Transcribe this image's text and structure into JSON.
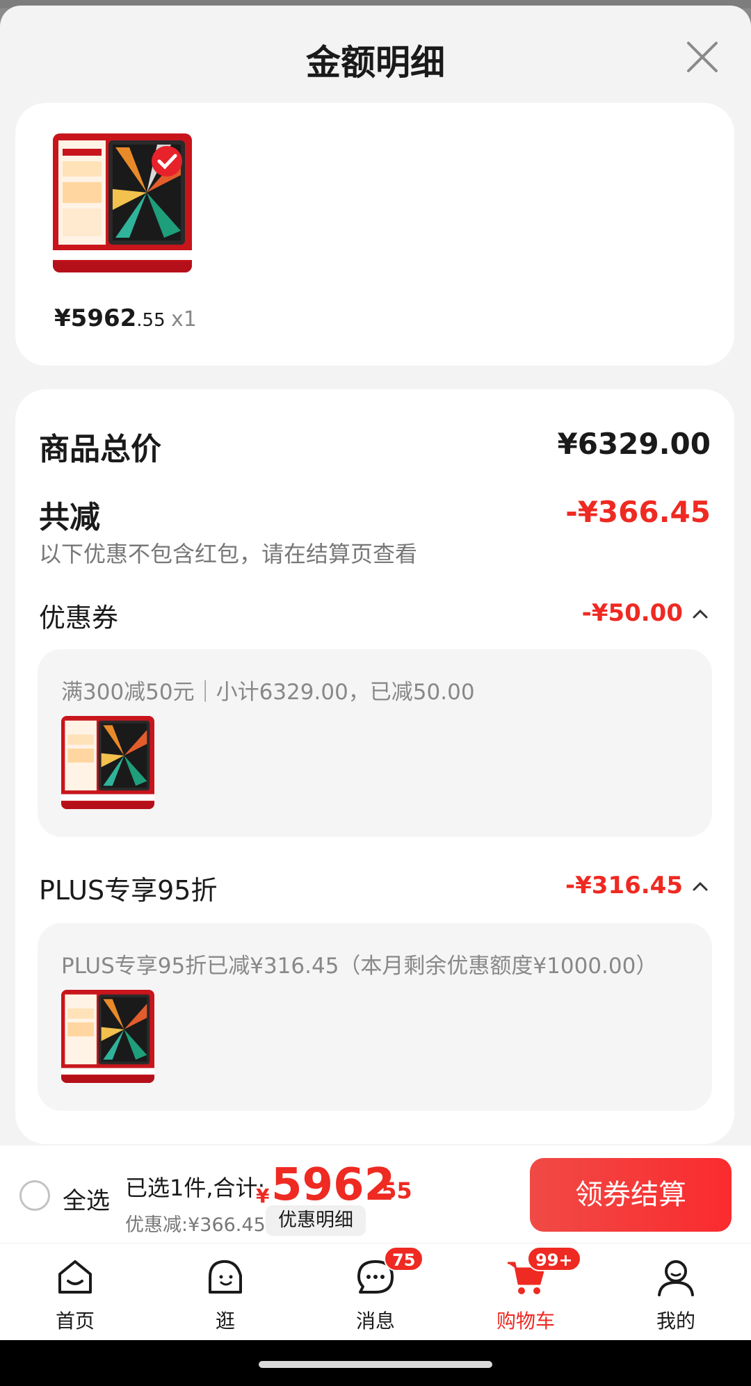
{
  "sheet": {
    "title": "金额明细"
  },
  "product": {
    "price_int": "¥5962",
    "price_dec": ".55",
    "qty": "x1"
  },
  "summary": {
    "total_label": "商品总价",
    "total_value": "¥6329.00",
    "reduce_label": "共减",
    "reduce_value": "-¥366.45",
    "reduce_note": "以下优惠不包含红包，请在结算页查看"
  },
  "coupon": {
    "label": "优惠券",
    "value": "-¥50.00",
    "detail": "满300减50元｜小计6329.00，已减50.00"
  },
  "plus": {
    "label": "PLUS专享95折",
    "value": "-¥316.45",
    "detail": "PLUS专享95折已减¥316.45（本月剩余优惠额度¥1000.00）"
  },
  "checkout": {
    "select_all": "全选",
    "selected_text": "已选1件,合计:",
    "total_yen": "¥",
    "total_int": "5962",
    "total_dec": ".55",
    "discount_text": "优惠减:¥366.45",
    "detail_chip": "优惠明细",
    "button": "领券结算"
  },
  "tabs": [
    {
      "label": "首页",
      "icon": "home-icon"
    },
    {
      "label": "逛",
      "icon": "explore-icon"
    },
    {
      "label": "消息",
      "icon": "message-icon",
      "badge": "75"
    },
    {
      "label": "购物车",
      "icon": "cart-icon",
      "badge": "99+",
      "active": true
    },
    {
      "label": "我的",
      "icon": "profile-icon"
    }
  ],
  "colors": {
    "accent": "#ee2a22",
    "background": "#f3f3f3",
    "card": "#ffffff"
  }
}
